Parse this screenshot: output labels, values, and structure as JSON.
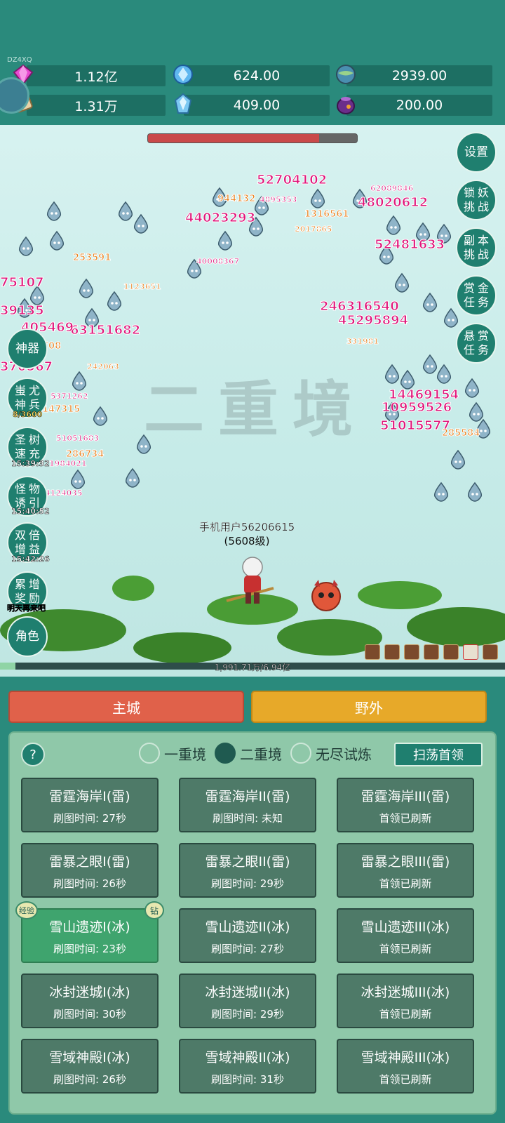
{
  "header": {
    "uid": "DZ4XQ",
    "resources": [
      {
        "icon": "pink-gem-icon",
        "value": "1.12亿"
      },
      {
        "icon": "blue-crystal-icon",
        "value": "624.00"
      },
      {
        "icon": "globe-orb-icon",
        "value": "2939.00"
      },
      {
        "icon": "scroll-icon",
        "value": "1.31万"
      },
      {
        "icon": "ice-crystal-icon",
        "value": "409.00"
      },
      {
        "icon": "purple-pot-icon",
        "value": "200.00"
      }
    ]
  },
  "scene": {
    "watermark": "二重境",
    "boss_hp_fraction": 0.82,
    "player": {
      "name": "手机用户56206615",
      "level": "(5608级)"
    },
    "exp": {
      "text": "1,991.71万/6.94亿",
      "fraction": 0.03
    },
    "left_buttons": [
      {
        "name": "shenqi",
        "label": "神器"
      },
      {
        "name": "chiyou",
        "label": "蚩尤神兵",
        "sub": "8/3600"
      },
      {
        "name": "shengshu",
        "label": "圣树速充",
        "sub": "15:39:32"
      },
      {
        "name": "guaiwu",
        "label": "怪物诱引",
        "sub": "15:40:52"
      },
      {
        "name": "shuangbei",
        "label": "双倍增益",
        "sub": "15:42:26"
      },
      {
        "name": "leizeng",
        "label": "累增奖励",
        "sub": "明天再来吧"
      },
      {
        "name": "juese",
        "label": "角色"
      }
    ],
    "right_buttons": [
      {
        "name": "settings",
        "label": "设置"
      },
      {
        "name": "lock-demon",
        "label": "锁妖挑战"
      },
      {
        "name": "dungeon",
        "label": "副本挑战"
      },
      {
        "name": "gold-task",
        "label": "赏金任务"
      },
      {
        "name": "bounty-task",
        "label": "悬赏任务"
      }
    ],
    "damage_numbers": [
      "52704102",
      "944132",
      "4895353",
      "62089846",
      "48020612",
      "1316561",
      "44023293",
      "2017865",
      "52481633",
      "40008367",
      "253591",
      "1123651",
      "246316540",
      "45295894",
      "331981",
      "63151682",
      "147315",
      "14469154",
      "10959526",
      "51015577",
      "285584",
      "286734",
      "51051683",
      "75107",
      "39135",
      "405469",
      "708",
      "370567",
      "242063",
      "1984021",
      "4124035",
      "5371262"
    ]
  },
  "nav": {
    "main_city": "主城",
    "wild": "野外"
  },
  "panel": {
    "help": "?",
    "realms": [
      {
        "label": "一重境",
        "selected": false
      },
      {
        "label": "二重境",
        "selected": true
      },
      {
        "label": "无尽试炼",
        "selected": false
      }
    ],
    "sweep_button": "扫荡首领",
    "tag_exp": "经验",
    "tag_diamond": "钻",
    "maps": [
      {
        "name": "雷霆海岸I(雷)",
        "time": "刷图时间: 27秒"
      },
      {
        "name": "雷霆海岸II(雷)",
        "time": "刷图时间: 未知"
      },
      {
        "name": "雷霆海岸III(雷)",
        "time": "首领已刷新"
      },
      {
        "name": "雷暴之眼I(雷)",
        "time": "刷图时间: 26秒"
      },
      {
        "name": "雷暴之眼II(雷)",
        "time": "刷图时间: 29秒"
      },
      {
        "name": "雷暴之眼III(雷)",
        "time": "首领已刷新"
      },
      {
        "name": "雪山遗迹I(冰)",
        "time": "刷图时间: 23秒"
      },
      {
        "name": "雪山遗迹II(冰)",
        "time": "刷图时间: 27秒"
      },
      {
        "name": "雪山遗迹III(冰)",
        "time": "首领已刷新"
      },
      {
        "name": "冰封迷城I(冰)",
        "time": "刷图时间: 30秒"
      },
      {
        "name": "冰封迷城II(冰)",
        "time": "刷图时间: 29秒"
      },
      {
        "name": "冰封迷城III(冰)",
        "time": "首领已刷新"
      },
      {
        "name": "雪域神殿I(冰)",
        "time": "刷图时间: 26秒"
      },
      {
        "name": "雪域神殿II(冰)",
        "time": "刷图时间: 31秒"
      },
      {
        "name": "雪域神殿III(冰)",
        "time": "首领已刷新"
      }
    ]
  }
}
